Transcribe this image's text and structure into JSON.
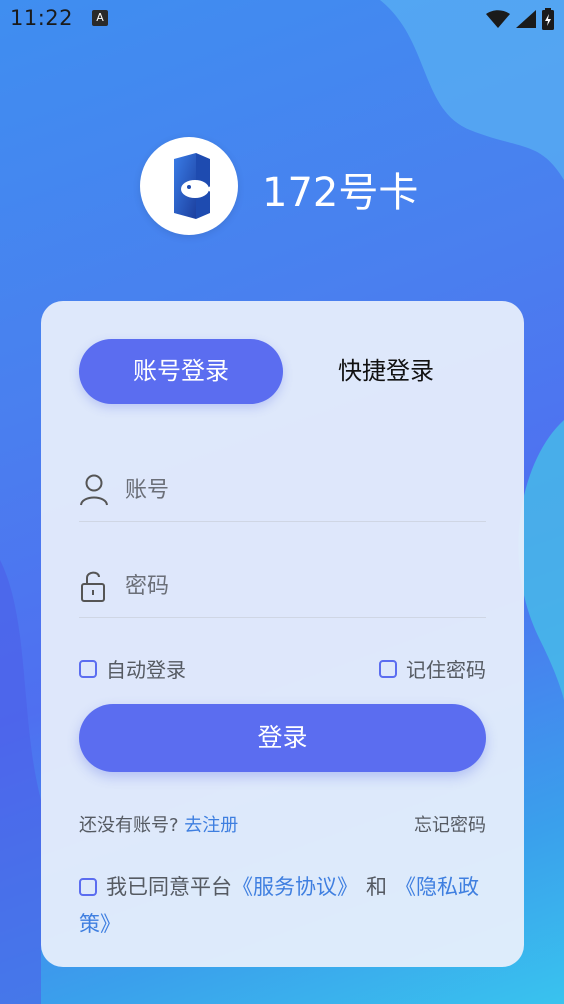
{
  "status_bar": {
    "time": "11:22",
    "notification_badge": "A",
    "icons": [
      "wifi-icon",
      "signal-icon",
      "battery-icon"
    ]
  },
  "brand": {
    "title": "172号卡",
    "logo_icon": "fish-logo-icon"
  },
  "login": {
    "tabs": [
      {
        "label": "账号登录",
        "active": true
      },
      {
        "label": "快捷登录",
        "active": false
      }
    ],
    "account_placeholder": "账号",
    "password_placeholder": "密码",
    "auto_login_label": "自动登录",
    "remember_password_label": "记住密码",
    "submit_label": "登录",
    "no_account_text": "还没有账号?",
    "register_link": "去注册",
    "forgot_password": "忘记密码",
    "agreement_prefix": "我已同意平台",
    "service_agreement": "《服务协议》",
    "agreement_and": "和",
    "privacy_policy": "《隐私政策》"
  },
  "colors": {
    "primary": "#5b6df0",
    "link": "#3f7fe0",
    "background_start": "#3f8ef0",
    "background_end": "#39c3ee"
  }
}
